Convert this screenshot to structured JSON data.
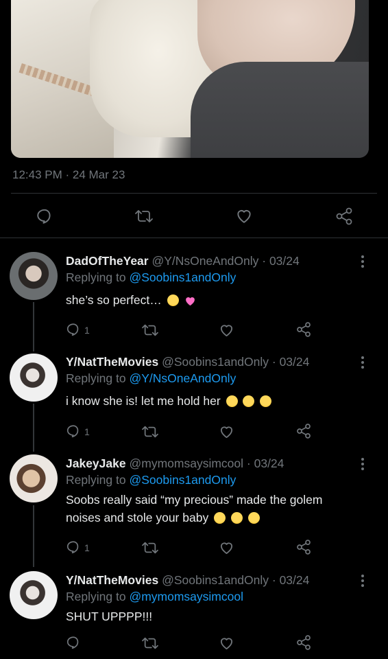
{
  "tweet": {
    "timestamp": "12:43 PM · 24 Mar 23"
  },
  "replies": [
    {
      "username": "DadOfTheYear",
      "handle": "@Y/NsOneAndOnly",
      "date": "03/24",
      "replying_label": "Replying to",
      "replying_to": "@Soobins1andOnly",
      "text": "she’s so perfect…",
      "emojis": [
        "loudly-crying-face",
        "growing-heart"
      ],
      "reply_count": "1"
    },
    {
      "username": "Y/NatTheMovies",
      "handle": "@Soobins1andOnly",
      "date": "03/24",
      "replying_label": "Replying to",
      "replying_to": "@Y/NsOneAndOnly",
      "text": "i know she is! let me hold her",
      "emojis": [
        "tired-face",
        "tired-face",
        "tired-face"
      ],
      "reply_count": "1"
    },
    {
      "username": "JakeyJake",
      "handle": "@mymomsaysimcool",
      "date": "03/24",
      "replying_label": "Replying to",
      "replying_to": "@Soobins1andOnly",
      "text_line1": "Soobs really said “my precious” made the golem",
      "text_line2": "noises and stole your baby",
      "emojis": [
        "face-with-tears-of-joy",
        "face-with-tears-of-joy",
        "face-with-tears-of-joy"
      ],
      "reply_count": "1"
    },
    {
      "username": "Y/NatTheMovies",
      "handle": "@Soobins1andOnly",
      "date": "03/24",
      "replying_label": "Replying to",
      "replying_to": "@mymomsaysimcool",
      "text": "SHUT UPPPP!!!",
      "reply_count": ""
    }
  ],
  "separator": "·",
  "colors": {
    "background": "#000000",
    "text": "#e7e9ea",
    "muted": "#71767b",
    "link": "#1d9bf0",
    "divider": "#2f3336"
  }
}
